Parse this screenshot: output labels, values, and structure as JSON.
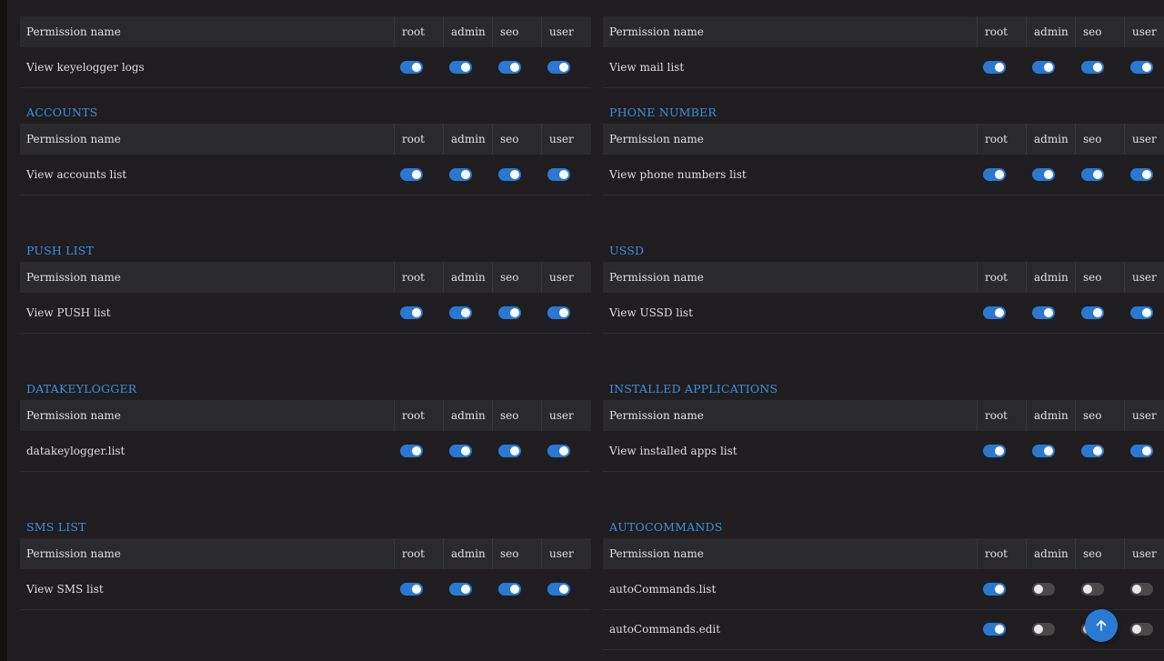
{
  "colors": {
    "accent": "#3d8fdd",
    "toggle_on": "#2979d2",
    "toggle_off": "#4a4848",
    "background": "#1f1d20",
    "header_bg": "#2a292d"
  },
  "icons": {
    "scroll_top": "arrow-up-icon"
  },
  "left": [
    {
      "title": "",
      "header": [
        "Permission name",
        "root",
        "admin",
        "seo",
        "user"
      ],
      "rows": [
        {
          "name": "View keyelogger logs",
          "perms": [
            true,
            true,
            true,
            true
          ]
        }
      ]
    },
    {
      "title": "ACCOUNTS",
      "header": [
        "Permission name",
        "root",
        "admin",
        "seo",
        "user"
      ],
      "rows": [
        {
          "name": "View accounts list",
          "perms": [
            true,
            true,
            true,
            true
          ]
        }
      ]
    },
    {
      "title": "PUSH LIST",
      "header": [
        "Permission name",
        "root",
        "admin",
        "seo",
        "user"
      ],
      "rows": [
        {
          "name": "View PUSH list",
          "perms": [
            true,
            true,
            true,
            true
          ]
        }
      ]
    },
    {
      "title": "DATAKEYLOGGER",
      "header": [
        "Permission name",
        "root",
        "admin",
        "seo",
        "user"
      ],
      "rows": [
        {
          "name": "datakeylogger.list",
          "perms": [
            true,
            true,
            true,
            true
          ]
        }
      ]
    },
    {
      "title": "SMS LIST",
      "header": [
        "Permission name",
        "root",
        "admin",
        "seo",
        "user"
      ],
      "rows": [
        {
          "name": "View SMS list",
          "perms": [
            true,
            true,
            true,
            true
          ]
        }
      ]
    }
  ],
  "right": [
    {
      "title": "",
      "header": [
        "Permission name",
        "root",
        "admin",
        "seo",
        "user"
      ],
      "rows": [
        {
          "name": "View mail list",
          "perms": [
            true,
            true,
            true,
            true
          ]
        }
      ]
    },
    {
      "title": "PHONE NUMBER",
      "header": [
        "Permission name",
        "root",
        "admin",
        "seo",
        "user"
      ],
      "rows": [
        {
          "name": "View phone numbers list",
          "perms": [
            true,
            true,
            true,
            true
          ]
        }
      ]
    },
    {
      "title": "USSD",
      "header": [
        "Permission name",
        "root",
        "admin",
        "seo",
        "user"
      ],
      "rows": [
        {
          "name": "View USSD list",
          "perms": [
            true,
            true,
            true,
            true
          ]
        }
      ]
    },
    {
      "title": "INSTALLED APPLICATIONS",
      "header": [
        "Permission name",
        "root",
        "admin",
        "seo",
        "user"
      ],
      "rows": [
        {
          "name": "View installed apps list",
          "perms": [
            true,
            true,
            true,
            true
          ]
        }
      ]
    },
    {
      "title": "AUTOCOMMANDS",
      "header": [
        "Permission name",
        "root",
        "admin",
        "seo",
        "user"
      ],
      "rows": [
        {
          "name": "autoCommands.list",
          "perms": [
            true,
            false,
            false,
            false
          ]
        },
        {
          "name": "autoCommands.edit",
          "perms": [
            true,
            false,
            false,
            false
          ]
        }
      ]
    }
  ]
}
